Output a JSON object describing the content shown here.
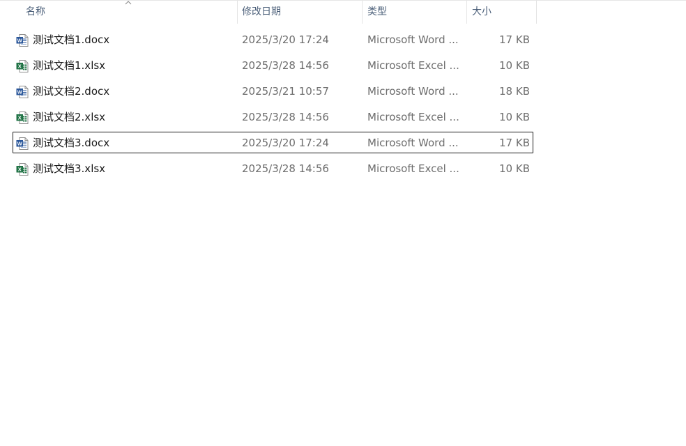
{
  "columns": {
    "name": "名称",
    "modified": "修改日期",
    "type": "类型",
    "size": "大小"
  },
  "sort": {
    "column": "name",
    "direction": "ascending",
    "indicator": "sort-ascending-icon"
  },
  "colors": {
    "header_text": "#4c607a",
    "name_text": "#1a1a1a",
    "meta_text": "#6d6d6d",
    "word_blue": "#2b579a",
    "excel_green": "#217346",
    "focus_border": "#1a1a1a"
  },
  "files": [
    {
      "name": "测试文档1.docx",
      "modified": "2025/3/20 17:24",
      "type": "Microsoft Word ...",
      "size": "17 KB",
      "icon": "word-document-icon",
      "focused": false
    },
    {
      "name": "测试文档1.xlsx",
      "modified": "2025/3/28 14:56",
      "type": "Microsoft Excel ...",
      "size": "10 KB",
      "icon": "excel-workbook-icon",
      "focused": false
    },
    {
      "name": "测试文档2.docx",
      "modified": "2025/3/21 10:57",
      "type": "Microsoft Word ...",
      "size": "18 KB",
      "icon": "word-document-icon",
      "focused": false
    },
    {
      "name": "测试文档2.xlsx",
      "modified": "2025/3/28 14:56",
      "type": "Microsoft Excel ...",
      "size": "10 KB",
      "icon": "excel-workbook-icon",
      "focused": false
    },
    {
      "name": "测试文档3.docx",
      "modified": "2025/3/20 17:24",
      "type": "Microsoft Word ...",
      "size": "17 KB",
      "icon": "word-document-icon",
      "focused": true
    },
    {
      "name": "测试文档3.xlsx",
      "modified": "2025/3/28 14:56",
      "type": "Microsoft Excel ...",
      "size": "10 KB",
      "icon": "excel-workbook-icon",
      "focused": false
    }
  ]
}
